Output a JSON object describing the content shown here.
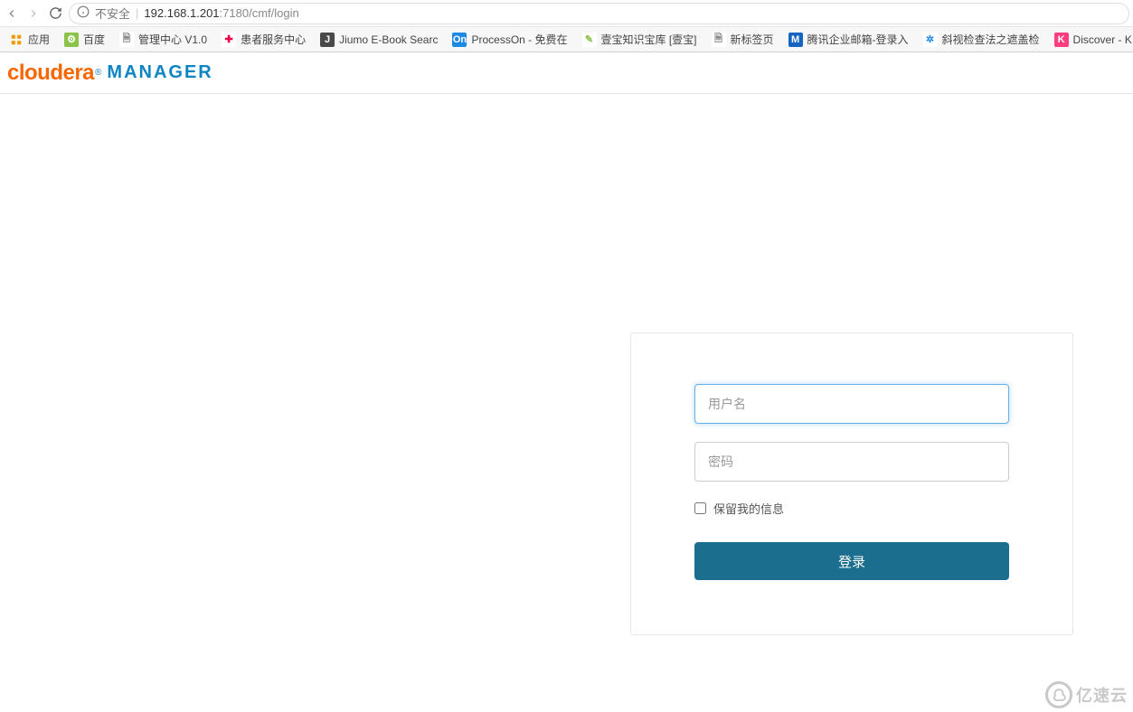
{
  "browser": {
    "security_label": "不安全",
    "url_host": "192.168.1.201",
    "url_port_path": ":7180/cmf/login"
  },
  "bookmarks": {
    "apps_label": "应用",
    "items": [
      {
        "label": "百度",
        "fav_bg": "#8bc34a",
        "fav_fg": "#fff",
        "fav_txt": "⚙"
      },
      {
        "label": "管理中心 V1.0",
        "fav_bg": "#fff",
        "fav_fg": "#888",
        "fav_txt": "🗎"
      },
      {
        "label": "患者服务中心",
        "fav_bg": "#fff",
        "fav_fg": "#e04",
        "fav_txt": "✚"
      },
      {
        "label": "Jiumo E-Book Searc",
        "fav_bg": "#4a4a4a",
        "fav_fg": "#fff",
        "fav_txt": "J"
      },
      {
        "label": "ProcessOn - 免费在",
        "fav_bg": "#1e88e5",
        "fav_fg": "#fff",
        "fav_txt": "On"
      },
      {
        "label": "壹宝知识宝库 [壹宝]",
        "fav_bg": "#fff",
        "fav_fg": "#8bc34a",
        "fav_txt": "✎"
      },
      {
        "label": "新标签页",
        "fav_bg": "#fff",
        "fav_fg": "#888",
        "fav_txt": "🗎"
      },
      {
        "label": "腾讯企业邮箱-登录入",
        "fav_bg": "#1565c0",
        "fav_fg": "#fff",
        "fav_txt": "M"
      },
      {
        "label": "斜视检查法之遮盖检",
        "fav_bg": "#fff",
        "fav_fg": "#1e88e5",
        "fav_txt": "✲"
      },
      {
        "label": "Discover - K",
        "fav_bg": "#ff3d7f",
        "fav_fg": "#fff",
        "fav_txt": "K"
      }
    ]
  },
  "brand": {
    "word1": "cloudera",
    "word2": "MANAGER"
  },
  "login": {
    "username_placeholder": "用户名",
    "password_placeholder": "密码",
    "remember_label": "保留我的信息",
    "submit_label": "登录"
  },
  "watermark": {
    "text": "亿速云"
  }
}
